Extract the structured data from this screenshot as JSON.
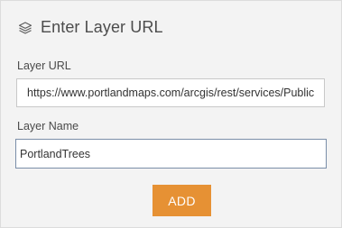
{
  "dialog": {
    "title": "Enter Layer URL",
    "icon": "layers-icon"
  },
  "form": {
    "url_label": "Layer URL",
    "url_value": "https://www.portlandmaps.com/arcgis/rest/services/Public",
    "name_label": "Layer Name",
    "name_value": "PortlandTrees",
    "add_label": "ADD"
  },
  "colors": {
    "accent": "#e69134",
    "background": "#f3f3f3",
    "focus_border": "#7a8ea8"
  }
}
